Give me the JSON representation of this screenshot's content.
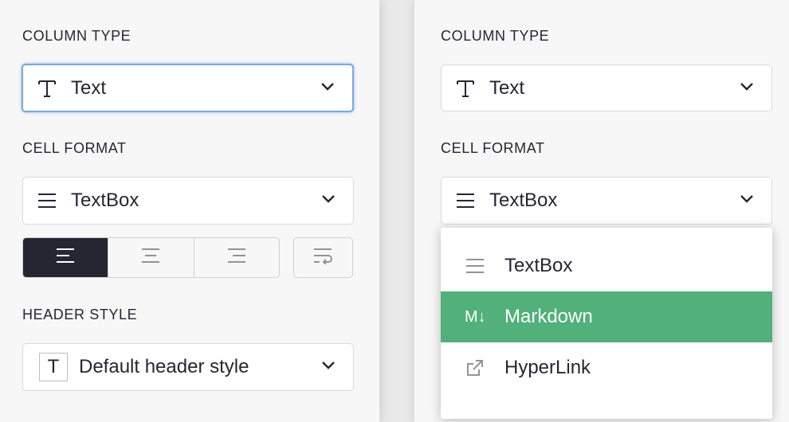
{
  "left": {
    "column_type_label": "COLUMN TYPE",
    "column_type_value": "Text",
    "cell_format_label": "CELL FORMAT",
    "cell_format_value": "TextBox",
    "header_style_label": "HEADER STYLE",
    "header_style_value": "Default header style",
    "header_style_icon_text": "T",
    "alignment_options": [
      "left",
      "center",
      "right"
    ],
    "alignment_selected": "left"
  },
  "right": {
    "column_type_label": "COLUMN TYPE",
    "column_type_value": "Text",
    "cell_format_label": "CELL FORMAT",
    "cell_format_value": "TextBox",
    "dropdown": {
      "options": [
        {
          "label": "TextBox",
          "icon": "lines-icon"
        },
        {
          "label": "Markdown",
          "icon": "markdown-icon",
          "icon_text": "M↓"
        },
        {
          "label": "HyperLink",
          "icon": "external-link-icon"
        }
      ],
      "highlighted": "Markdown"
    }
  },
  "colors": {
    "highlight": "#52b07a",
    "dark": "#262633",
    "focus": "#79a8e0"
  }
}
